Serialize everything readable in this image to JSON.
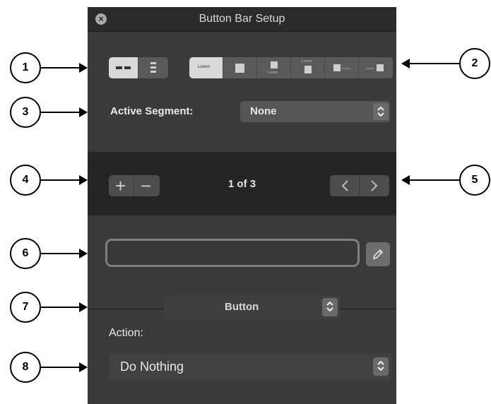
{
  "window": {
    "title": "Button Bar Setup",
    "close_icon": "close-icon"
  },
  "layout_toggle": {
    "options": [
      "horizontal-layout-icon",
      "vertical-layout-icon"
    ],
    "selected": 0
  },
  "display_style": {
    "options": [
      "text-only",
      "image-only",
      "image-above-text",
      "text-above-image",
      "image-left-of-text",
      "text-left-of-image"
    ],
    "selected": 0,
    "sample_text": "Lorem"
  },
  "active_segment": {
    "label": "Active Segment:",
    "value": "None"
  },
  "segment_nav": {
    "add_symbol": "+",
    "remove_symbol": "−",
    "counter": "1 of 3"
  },
  "name_field": {
    "value": "",
    "edit_icon": "pencil-icon"
  },
  "type_popup": {
    "value": "Button"
  },
  "action": {
    "label": "Action:",
    "value": "Do Nothing"
  },
  "callouts": [
    "1",
    "2",
    "3",
    "4",
    "5",
    "6",
    "7",
    "8"
  ],
  "colors": {
    "panel": "#3a3a3a",
    "titlebar": "#2b2b2b",
    "band": "#252525",
    "popup": "#555555",
    "text": "#e6e6e6"
  }
}
